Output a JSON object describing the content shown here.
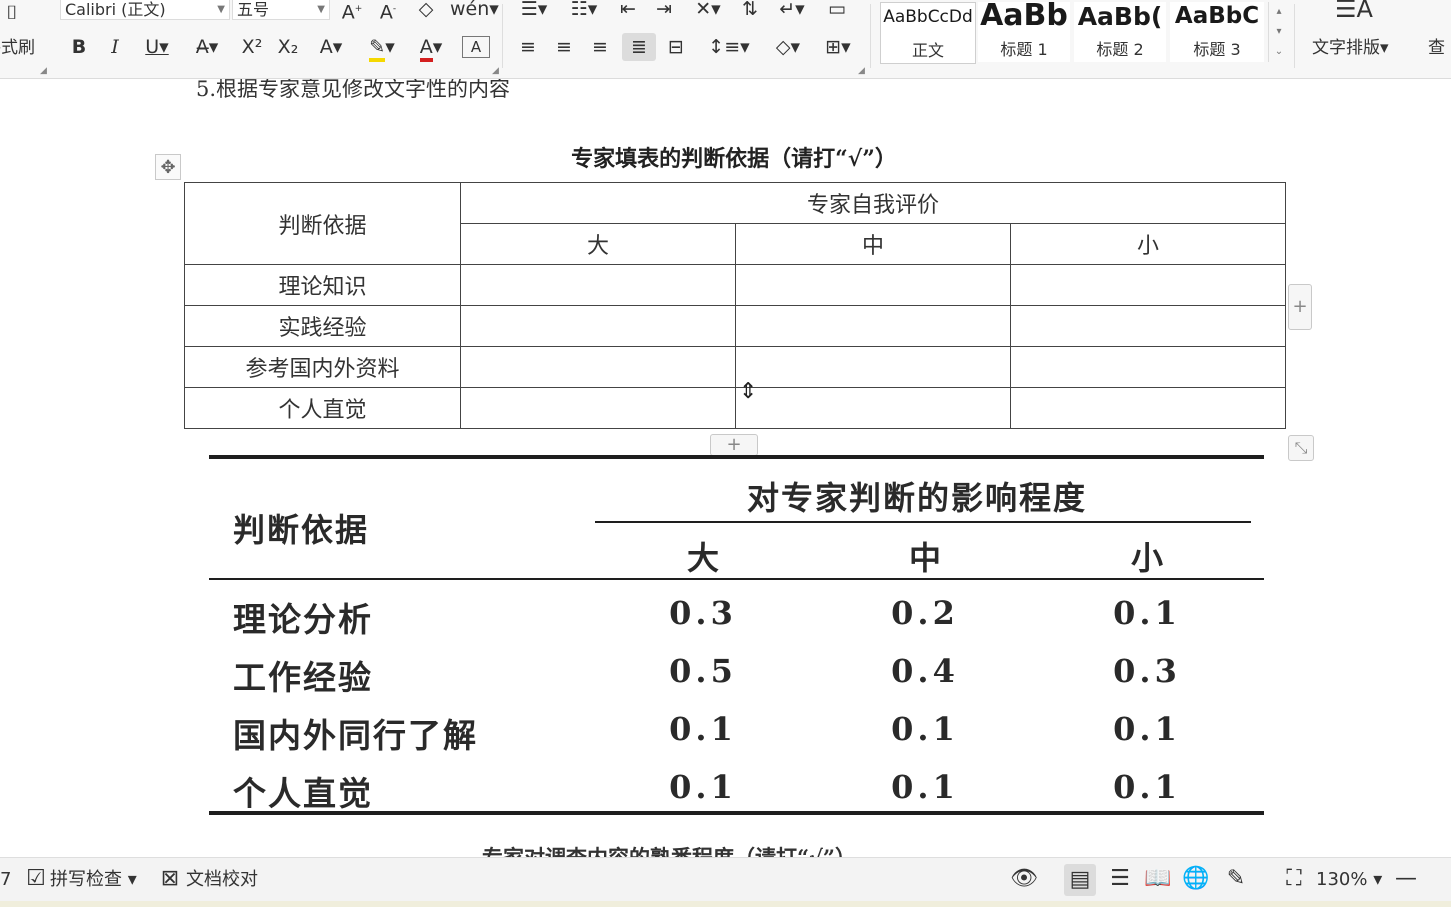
{
  "ribbon": {
    "format_painter_label": "格式刷",
    "font_name": "Calibri (正文)",
    "font_size": "五号",
    "styles": [
      {
        "preview": "AaBbCcDd",
        "label": "正文"
      },
      {
        "preview": "AaBb",
        "label": "标题 1"
      },
      {
        "preview": "AaBb(",
        "label": "标题 2"
      },
      {
        "preview": "AaBbC",
        "label": "标题 3"
      }
    ],
    "text_layout_label": "文字排版",
    "find_label": "查"
  },
  "document": {
    "partial_top_line": "5.根据专家意见修改文字性的内容",
    "table1": {
      "caption": "专家填表的判断依据（请打“√”）",
      "header_basis": "判断依据",
      "header_group": "专家自我评价",
      "levels": [
        "大",
        "中",
        "小"
      ],
      "rows": [
        "理论知识",
        "实践经验",
        "参考国内外资料",
        "个人直觉"
      ]
    },
    "table2": {
      "header_basis": "判断依据",
      "header_group": "对专家判断的影响程度",
      "levels": [
        "大",
        "中",
        "小"
      ],
      "rows": [
        {
          "label": "理论分析",
          "values": [
            "0.3",
            "0.2",
            "0.1"
          ]
        },
        {
          "label": "工作经验",
          "values": [
            "0.5",
            "0.4",
            "0.3"
          ]
        },
        {
          "label": "国内外同行了解",
          "values": [
            "0.1",
            "0.1",
            "0.1"
          ]
        },
        {
          "label": "个人直觉",
          "values": [
            "0.1",
            "0.1",
            "0.1"
          ]
        }
      ]
    },
    "partial_bottom_line": "专家对调查内容的熟悉程度（请打“√”）"
  },
  "statusbar": {
    "page_fragment": "7",
    "spell_check_label": "拼写检查",
    "doc_proof_label": "文档校对",
    "zoom": "130%"
  }
}
